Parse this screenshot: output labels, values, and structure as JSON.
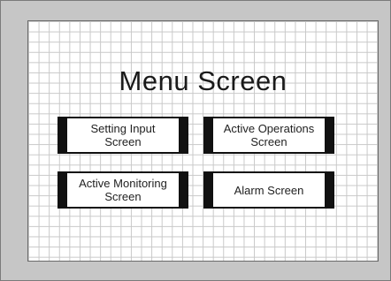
{
  "screen": {
    "title": "Menu Screen"
  },
  "menu": {
    "setting_input": "Setting Input\nScreen",
    "active_operations": "Active Operations\nScreen",
    "active_monitoring": "Active Monitoring\nScreen",
    "alarm": "Alarm Screen"
  },
  "colors": {
    "bezel": "#c6c6c6",
    "grid_line": "#c8c8c8",
    "button_border": "#111111"
  }
}
